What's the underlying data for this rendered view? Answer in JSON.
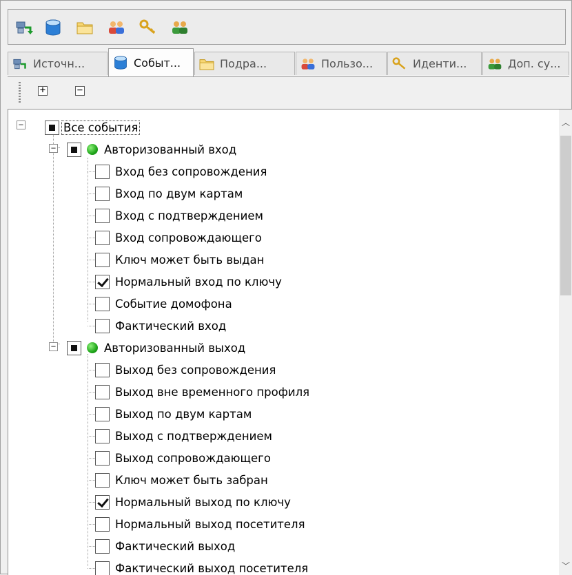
{
  "toolbar": {
    "icons": [
      "sources-icon",
      "events-icon",
      "folder-icon",
      "users-icon",
      "keys-icon",
      "extra-subjects-icon"
    ]
  },
  "tabs": [
    {
      "label": "Источн...",
      "icon": "sources-icon",
      "active": false
    },
    {
      "label": "Событ...",
      "icon": "events-icon",
      "active": true
    },
    {
      "label": "Подра...",
      "icon": "folder-icon",
      "active": false
    },
    {
      "label": "Пользо...",
      "icon": "users-icon",
      "active": false
    },
    {
      "label": "Иденти...",
      "icon": "keys-icon",
      "active": false
    },
    {
      "label": "Доп. су...",
      "icon": "extra-subjects-icon",
      "active": false
    }
  ],
  "mini_toolbar": {
    "expand_all": "+",
    "collapse_all": "−"
  },
  "tree": {
    "root": {
      "label": "Все события",
      "state": "indeterminate"
    },
    "groups": [
      {
        "label": "Авторизованный вход",
        "state": "indeterminate",
        "status_color": "#2db82a",
        "items": [
          {
            "label": "Вход без сопровождения",
            "checked": false
          },
          {
            "label": "Вход по двум картам",
            "checked": false
          },
          {
            "label": "Вход с подтверждением",
            "checked": false
          },
          {
            "label": "Вход сопровождающего",
            "checked": false
          },
          {
            "label": "Ключ может быть выдан",
            "checked": false
          },
          {
            "label": "Нормальный вход по ключу",
            "checked": true
          },
          {
            "label": "Событие домофона",
            "checked": false
          },
          {
            "label": "Фактический вход",
            "checked": false
          }
        ]
      },
      {
        "label": "Авторизованный выход",
        "state": "indeterminate",
        "status_color": "#2db82a",
        "items": [
          {
            "label": "Выход без сопровождения",
            "checked": false
          },
          {
            "label": "Выход вне временного профиля",
            "checked": false
          },
          {
            "label": "Выход по двум картам",
            "checked": false
          },
          {
            "label": "Выход с подтверждением",
            "checked": false
          },
          {
            "label": "Выход сопровождающего",
            "checked": false
          },
          {
            "label": "Ключ может быть забран",
            "checked": false
          },
          {
            "label": "Нормальный выход по ключу",
            "checked": true
          },
          {
            "label": "Нормальный выход посетителя",
            "checked": false
          },
          {
            "label": "Фактический выход",
            "checked": false
          },
          {
            "label": "Фактический выход посетителя",
            "checked": false
          }
        ]
      }
    ]
  }
}
